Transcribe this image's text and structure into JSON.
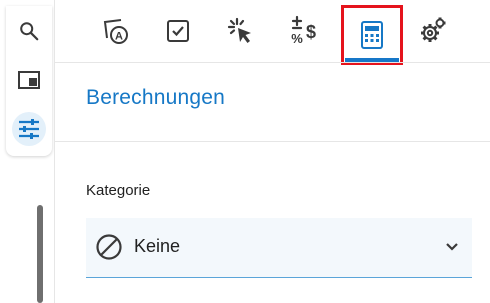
{
  "rail": {
    "items": [
      {
        "icon": "search-icon"
      },
      {
        "icon": "window-icon"
      },
      {
        "icon": "sliders-icon",
        "active": true
      }
    ]
  },
  "toolbar": {
    "tools": [
      {
        "icon": "text-label-icon"
      },
      {
        "icon": "checkbox-icon"
      },
      {
        "icon": "click-pointer-icon"
      },
      {
        "icon": "plus-minus-percent-dollar-icon"
      },
      {
        "icon": "calculator-icon",
        "selected": true
      },
      {
        "icon": "gears-icon"
      }
    ]
  },
  "section": {
    "title": "Berechnungen"
  },
  "category": {
    "label": "Kategorie",
    "value": "Keine",
    "icon": "none-icon"
  },
  "colors": {
    "accent": "#1678c6",
    "highlight": "#e5131c",
    "field_bg": "#f3f8fc"
  }
}
